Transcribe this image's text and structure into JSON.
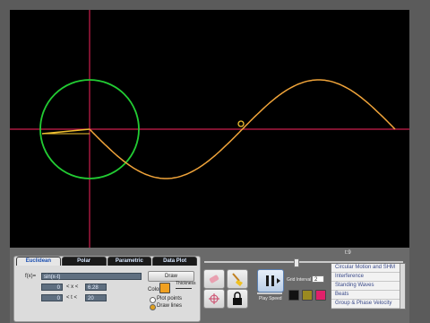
{
  "plot": {
    "background": "#000000",
    "axes_color": "#cc1f4d",
    "circle_color": "#22cc33",
    "wave_color": "#f0a43a"
  },
  "time_label": "t:9",
  "tabs": [
    "Euclidean",
    "Polar",
    "Parametric",
    "Data Plot"
  ],
  "function": {
    "prefix": "f(x)=",
    "expression": "sin(x-t)"
  },
  "x_range": {
    "min": "0",
    "op": "< x <",
    "max": "6.28"
  },
  "t_range": {
    "min": "0",
    "op": "< t <",
    "max": "20"
  },
  "draw_button": "Draw",
  "color_label": "Color",
  "thickness_label": "Thickness",
  "plot_points_label": "Plot points",
  "draw_lines_label": "Draw lines",
  "grid_interval_label": "Grid Interval",
  "grid_interval_value": "2",
  "play_speed_label": "Play Speed",
  "swatches": [
    "#111111",
    "#9a8a20",
    "#e0206a"
  ],
  "presets": [
    "Circular Motion and SHM",
    "Interference",
    "Standing Waves",
    "Beats",
    "Group & Phase Velocity"
  ]
}
